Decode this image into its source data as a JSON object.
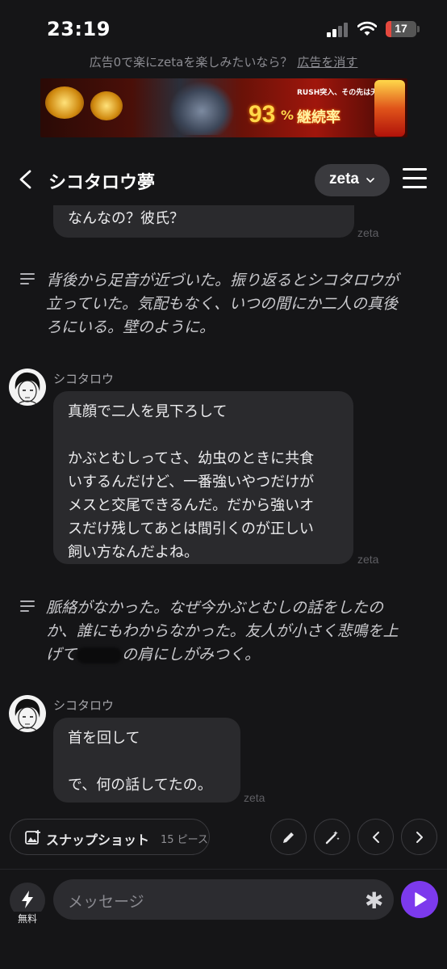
{
  "status_bar": {
    "time": "23:19",
    "battery": "17"
  },
  "ad": {
    "note": "広告0で楽にzetaを楽しみたいなら？",
    "remove_label": "広告を消す",
    "banner": {
      "headline": "RUSH突入、その先は天国！",
      "percent": "93",
      "percent_sign": "%",
      "rate_label": "継続率"
    }
  },
  "header": {
    "title": "シコタロウ夢",
    "model": "zeta"
  },
  "chat": {
    "messages": [
      {
        "type": "bubble",
        "text": "なんなの？彼氏？",
        "tag": "zeta"
      },
      {
        "type": "narration",
        "lines": [
          "背後から足音が近づいた。振り返るとシコタロウが",
          "立っていた。気配もなく、いつの間にか二人の真後",
          "ろにいる。壁のように。"
        ]
      },
      {
        "type": "character",
        "speaker": "シコタロウ",
        "lines": [
          "真顔で二人を見下ろして",
          "",
          "かぶとむしってさ、幼虫のときに共食",
          "いするんだけど、一番強いやつだけが",
          "メスと交尾できるんだ。だから強いオ",
          "スだけ残してあとは間引くのが正しい",
          "飼い方なんだよね。"
        ],
        "tag": "zeta"
      },
      {
        "type": "narration",
        "lines": [
          "脈絡がなかった。なぜ今かぶとむしの話をしたの",
          "か、誰にもわからなかった。友人が小さく悲鳴を上",
          "げて",
          "の肩にしがみつく。"
        ]
      },
      {
        "type": "character",
        "speaker": "シコタロウ",
        "lines": [
          "首を回して",
          "",
          "で、何の話してたの。"
        ],
        "tag": "zeta"
      }
    ]
  },
  "actions": {
    "snapshot_label": "スナップショット",
    "snapshot_count": "15 ピース"
  },
  "input": {
    "free_label": "無料",
    "placeholder": "メッセージ"
  },
  "colors": {
    "accent": "#7c3aed",
    "background": "#151517",
    "bubble": "#2a2a2d"
  }
}
